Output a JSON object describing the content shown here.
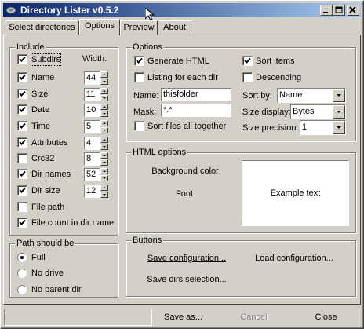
{
  "window": {
    "title": "Directory Lister v0.5.2"
  },
  "tabs": [
    "Select directories",
    "Options",
    "Preview",
    "About"
  ],
  "include": {
    "title": "Include",
    "width_label": "Width:",
    "items": [
      {
        "label": "Subdirs",
        "checked": true,
        "width": null
      },
      {
        "label": "Name",
        "checked": true,
        "width": "44"
      },
      {
        "label": "Size",
        "checked": true,
        "width": "11"
      },
      {
        "label": "Date",
        "checked": true,
        "width": "10"
      },
      {
        "label": "Time",
        "checked": true,
        "width": "5"
      },
      {
        "label": "Attributes",
        "checked": true,
        "width": "4"
      },
      {
        "label": "Crc32",
        "checked": false,
        "width": "8"
      },
      {
        "label": "Dir names",
        "checked": true,
        "width": "52"
      },
      {
        "label": "Dir size",
        "checked": true,
        "width": "12"
      },
      {
        "label": "File path",
        "checked": false,
        "width": null
      },
      {
        "label": "File count in dir name",
        "checked": true,
        "width": null
      }
    ]
  },
  "path": {
    "title": "Path should be",
    "options": [
      "Full",
      "No drive",
      "No parent dir"
    ],
    "selected": 0
  },
  "options": {
    "title": "Options",
    "generate_html": {
      "label": "Generate HTML",
      "checked": true
    },
    "listing_each": {
      "label": "Listing for each dir",
      "checked": false
    },
    "name_label": "Name:",
    "name_value": "thisfolder",
    "mask_label": "Mask:",
    "mask_value": "*.*",
    "sort_files": {
      "label": "Sort files all together",
      "checked": false
    },
    "sort_items": {
      "label": "Sort items",
      "checked": true
    },
    "descending": {
      "label": "Descending",
      "checked": false
    },
    "sort_by_label": "Sort by:",
    "sort_by_value": "Name",
    "size_display_label": "Size display:",
    "size_display_value": "Bytes",
    "size_precision_label": "Size precision:",
    "size_precision_value": "1"
  },
  "html_options": {
    "title": "HTML options",
    "background_label": "Background color",
    "font_label": "Font",
    "example_text": "Example text"
  },
  "buttons_group": {
    "title": "Buttons",
    "save_config": "Save configuration...",
    "load_config": "Load configuration...",
    "save_dirs": "Save dirs selection..."
  },
  "bottom": {
    "save_as": "Save as...",
    "cancel": "Cancel",
    "close": "Close"
  }
}
